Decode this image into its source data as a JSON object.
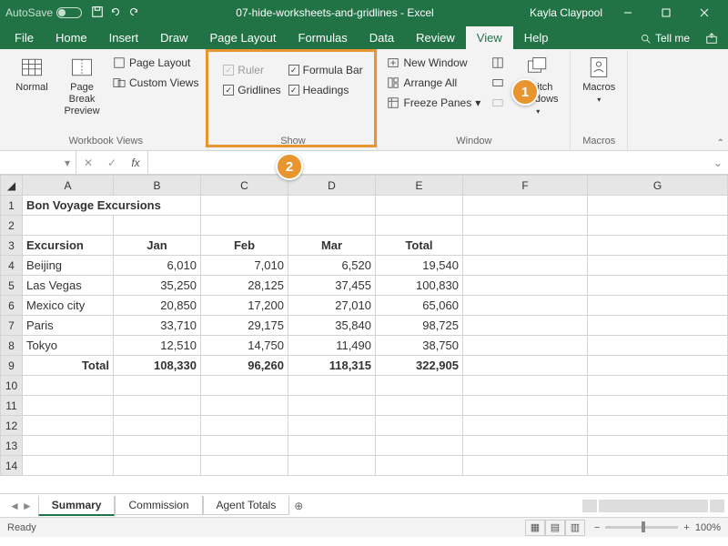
{
  "titlebar": {
    "autosave": "AutoSave",
    "docname": "07-hide-worksheets-and-gridlines - Excel",
    "user": "Kayla Claypool"
  },
  "tabs": [
    "File",
    "Home",
    "Insert",
    "Draw",
    "Page Layout",
    "Formulas",
    "Data",
    "Review",
    "View",
    "Help"
  ],
  "active_tab": "View",
  "tell_me": "Tell me",
  "ribbon": {
    "workbook_views": {
      "label": "Workbook Views",
      "normal": "Normal",
      "page_break": "Page Break Preview",
      "page_layout": "Page Layout",
      "custom_views": "Custom Views"
    },
    "show": {
      "label": "Show",
      "ruler": "Ruler",
      "gridlines": "Gridlines",
      "formula_bar": "Formula Bar",
      "headings": "Headings"
    },
    "window": {
      "label": "Window",
      "new_window": "New Window",
      "arrange_all": "Arrange All",
      "freeze_panes": "Freeze Panes",
      "switch_windows": "Switch Windows"
    },
    "macros": {
      "label": "Macros",
      "macros": "Macros"
    }
  },
  "callouts": {
    "one": "1",
    "two": "2"
  },
  "namebox": "",
  "columns": [
    "A",
    "B",
    "C",
    "D",
    "E",
    "F",
    "G"
  ],
  "sheet": {
    "title": "Bon Voyage Excursions",
    "headers": [
      "Excursion",
      "Jan",
      "Feb",
      "Mar",
      "Total"
    ],
    "rows": [
      {
        "name": "Beijing",
        "jan": "6,010",
        "feb": "7,010",
        "mar": "6,520",
        "total": "19,540"
      },
      {
        "name": "Las Vegas",
        "jan": "35,250",
        "feb": "28,125",
        "mar": "37,455",
        "total": "100,830"
      },
      {
        "name": "Mexico city",
        "jan": "20,850",
        "feb": "17,200",
        "mar": "27,010",
        "total": "65,060"
      },
      {
        "name": "Paris",
        "jan": "33,710",
        "feb": "29,175",
        "mar": "35,840",
        "total": "98,725"
      },
      {
        "name": "Tokyo",
        "jan": "12,510",
        "feb": "14,750",
        "mar": "11,490",
        "total": "38,750"
      }
    ],
    "totals": {
      "name": "Total",
      "jan": "108,330",
      "feb": "96,260",
      "mar": "118,315",
      "total": "322,905"
    }
  },
  "sheet_tabs": [
    "Summary",
    "Commission",
    "Agent Totals"
  ],
  "active_sheet": "Summary",
  "status": {
    "ready": "Ready",
    "zoom": "100%"
  }
}
